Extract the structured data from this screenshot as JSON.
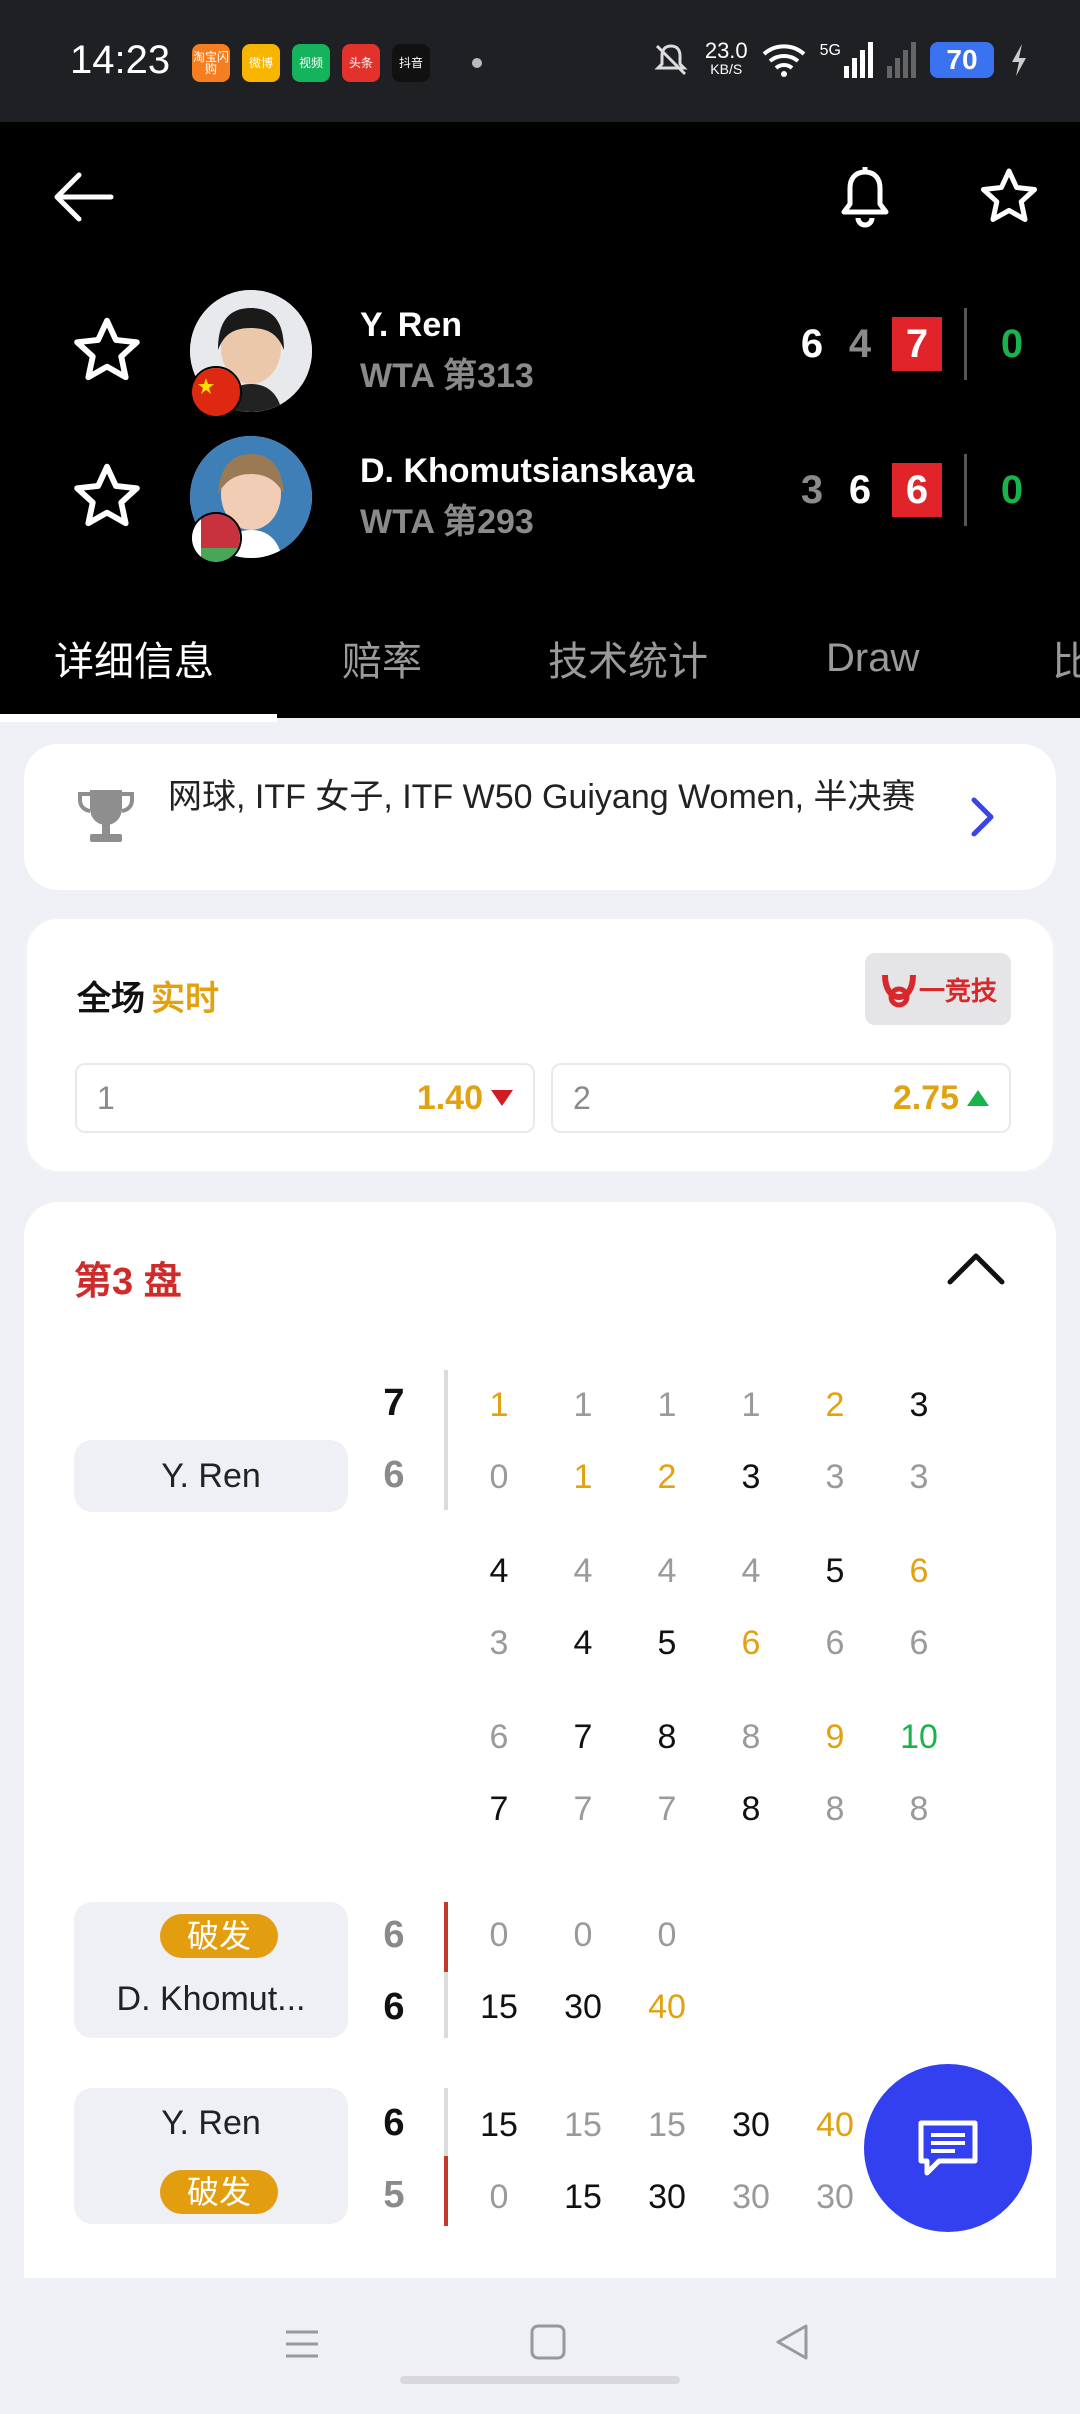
{
  "status_bar": {
    "time": "14:23",
    "apps": [
      "淘宝闪购",
      "微博",
      "视频",
      "头条",
      "抖音"
    ],
    "net_speed_value": "23.0",
    "net_speed_unit": "KB/S",
    "network": "5G",
    "battery": "70"
  },
  "header": {
    "back_icon": "arrow-left-icon",
    "bell_icon": "bell-icon",
    "favorite_icon": "star-outline-icon"
  },
  "players": [
    {
      "name": "Y. Ren",
      "rank": "WTA 第313",
      "flag": "china",
      "set_scores": [
        "6",
        "4",
        "7"
      ],
      "set_win": [
        true,
        false,
        true
      ],
      "current_points": "0"
    },
    {
      "name": "D. Khomutsianskaya",
      "rank": "WTA 第293",
      "flag": "belarus",
      "set_scores": [
        "3",
        "6",
        "6"
      ],
      "set_win": [
        false,
        true,
        true
      ],
      "current_points": "0"
    }
  ],
  "tabs": [
    "详细信息",
    "赔率",
    "技术统计",
    "Draw",
    "比"
  ],
  "active_tab": 0,
  "competition": {
    "text": "网球, ITF 女子, ITF W50 Guiyang Women, 半决赛",
    "trophy_icon": "trophy-icon",
    "chevron_icon": "chevron-right-icon"
  },
  "odds": {
    "title": "全场",
    "live": "实时",
    "sponsor": "一竞技",
    "options": [
      {
        "label": "1",
        "value": "1.40",
        "trend": "down"
      },
      {
        "label": "2",
        "value": "2.75",
        "trend": "up"
      }
    ]
  },
  "set_section": {
    "title": "第3 盘",
    "collapse_icon": "chevron-up-icon",
    "tiebreak": {
      "player": "Y. Ren",
      "score_top": "7",
      "score_bottom": "6",
      "rows": [
        [
          {
            "v": "1",
            "c": "org"
          },
          {
            "v": "1",
            "c": "gry"
          },
          {
            "v": "1",
            "c": "gry"
          },
          {
            "v": "1",
            "c": "gry"
          },
          {
            "v": "2",
            "c": "org"
          },
          {
            "v": "3",
            "c": "blk"
          }
        ],
        [
          {
            "v": "0",
            "c": "gry"
          },
          {
            "v": "1",
            "c": "org"
          },
          {
            "v": "2",
            "c": "org"
          },
          {
            "v": "3",
            "c": "blk"
          },
          {
            "v": "3",
            "c": "gry"
          },
          {
            "v": "3",
            "c": "gry"
          }
        ],
        [
          {
            "v": "4",
            "c": "blk"
          },
          {
            "v": "4",
            "c": "gry"
          },
          {
            "v": "4",
            "c": "gry"
          },
          {
            "v": "4",
            "c": "gry"
          },
          {
            "v": "5",
            "c": "blk"
          },
          {
            "v": "6",
            "c": "org"
          }
        ],
        [
          {
            "v": "3",
            "c": "gry"
          },
          {
            "v": "4",
            "c": "blk"
          },
          {
            "v": "5",
            "c": "blk"
          },
          {
            "v": "6",
            "c": "org"
          },
          {
            "v": "6",
            "c": "gry"
          },
          {
            "v": "6",
            "c": "gry"
          }
        ],
        [
          {
            "v": "6",
            "c": "gry"
          },
          {
            "v": "7",
            "c": "blk"
          },
          {
            "v": "8",
            "c": "blk"
          },
          {
            "v": "8",
            "c": "gry"
          },
          {
            "v": "9",
            "c": "org"
          },
          {
            "v": "10",
            "c": "grn"
          }
        ],
        [
          {
            "v": "7",
            "c": "blk"
          },
          {
            "v": "7",
            "c": "gry"
          },
          {
            "v": "7",
            "c": "gry"
          },
          {
            "v": "8",
            "c": "blk"
          },
          {
            "v": "8",
            "c": "gry"
          },
          {
            "v": "8",
            "c": "gry"
          }
        ]
      ]
    },
    "game1": {
      "badge": "破发",
      "player": "D. Khomut...",
      "score_top": "6",
      "score_bottom": "6",
      "rows": [
        [
          {
            "v": "0",
            "c": "gry"
          },
          {
            "v": "0",
            "c": "gry"
          },
          {
            "v": "0",
            "c": "gry"
          }
        ],
        [
          {
            "v": "15",
            "c": "blk"
          },
          {
            "v": "30",
            "c": "blk"
          },
          {
            "v": "40",
            "c": "org"
          }
        ]
      ]
    },
    "game2": {
      "player": "Y. Ren",
      "badge": "破发",
      "score_top": "6",
      "score_bottom": "5",
      "rows": [
        [
          {
            "v": "15",
            "c": "blk"
          },
          {
            "v": "15",
            "c": "gry"
          },
          {
            "v": "15",
            "c": "gry"
          },
          {
            "v": "30",
            "c": "blk"
          },
          {
            "v": "40",
            "c": "org"
          }
        ],
        [
          {
            "v": "0",
            "c": "gry"
          },
          {
            "v": "15",
            "c": "blk"
          },
          {
            "v": "30",
            "c": "blk"
          },
          {
            "v": "30",
            "c": "gry"
          },
          {
            "v": "30",
            "c": "gry"
          }
        ]
      ]
    }
  },
  "fab_icon": "chat-icon",
  "nav": [
    "menu-icon",
    "home-square-icon",
    "back-triangle-icon"
  ]
}
